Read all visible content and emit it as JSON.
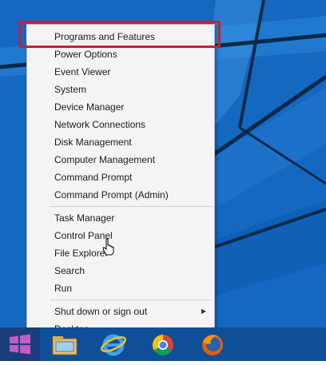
{
  "menu": {
    "groups": [
      {
        "items": [
          {
            "label": "Programs and Features"
          },
          {
            "label": "Power Options"
          },
          {
            "label": "Event Viewer"
          },
          {
            "label": "System"
          },
          {
            "label": "Device Manager"
          },
          {
            "label": "Network Connections"
          },
          {
            "label": "Disk Management"
          },
          {
            "label": "Computer Management"
          },
          {
            "label": "Command Prompt"
          },
          {
            "label": "Command Prompt (Admin)"
          }
        ]
      },
      {
        "items": [
          {
            "label": "Task Manager"
          },
          {
            "label": "Control Panel"
          },
          {
            "label": "File Explorer"
          },
          {
            "label": "Search"
          },
          {
            "label": "Run"
          }
        ]
      },
      {
        "items": [
          {
            "label": "Shut down or sign out",
            "submenu": true
          },
          {
            "label": "Desktop"
          }
        ]
      }
    ],
    "highlighted_item": "Programs and Features",
    "highlight_color": "#c0223b"
  },
  "taskbar": {
    "buttons": [
      {
        "icon": "windows-logo-icon"
      },
      {
        "icon": "file-explorer-icon"
      },
      {
        "icon": "internet-explorer-icon"
      },
      {
        "icon": "chrome-icon"
      },
      {
        "icon": "firefox-icon"
      }
    ]
  },
  "colors": {
    "desktop": "#1468c0",
    "taskbar": "#0e4f99",
    "menu_bg": "#f4f4f4"
  }
}
